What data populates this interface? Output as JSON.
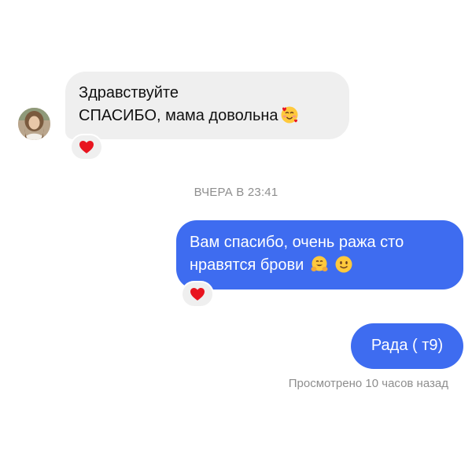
{
  "conversation": {
    "incoming_message": {
      "line1": "Здравствуйте",
      "line2": "СПАСИБО, мама довольна",
      "emoji": "smiling-face-with-hearts-icon",
      "reaction": "heart-icon"
    },
    "timestamp_divider": "ВЧЕРА В 23:41",
    "outgoing_message_1": {
      "line1": "Вам спасибо, очень ража сто",
      "line2": "нравятся брови",
      "emojis": [
        "hugging-face-icon",
        "slightly-smiling-face-icon"
      ],
      "reaction": "heart-icon"
    },
    "outgoing_message_2": {
      "text": "Рада ( т9)"
    },
    "seen_status": "Просмотрено 10 часов назад"
  },
  "colors": {
    "outgoing_bubble": "#3e6cf0",
    "incoming_bubble": "#efefef",
    "meta_text": "#8e8e8e",
    "heart": "#e8141f"
  }
}
